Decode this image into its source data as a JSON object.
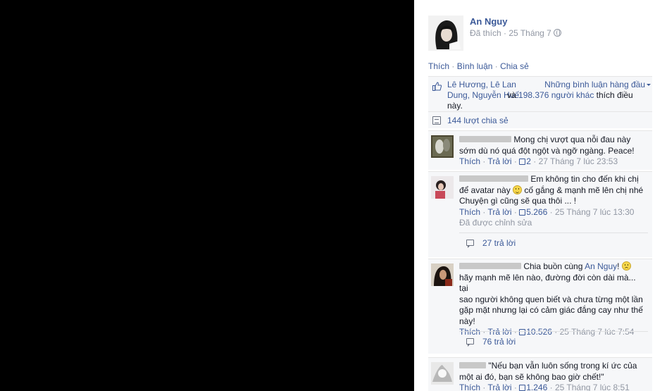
{
  "post": {
    "author": "An Nguy",
    "meta": "Đã thích · 25 Tháng 7",
    "actions": {
      "like": "Thích",
      "comment": "Bình luận",
      "share": "Chia sẻ"
    }
  },
  "likes": {
    "text_line1": "Lê Hương, Lê Lan",
    "text_line2": "Dung, Nguyễn Huế",
    "and": " và ",
    "others": "198.376 người khác",
    "tail": "thích điều",
    "tail2": "này.",
    "top_comments": "Những bình luận hàng đầu"
  },
  "shares": "144 lượt chia sẻ",
  "comments": [
    {
      "line1": "Mong chị vượt qua nỗi đau này",
      "line2": "sớm dù nó quá đột ngột và ngỡ ngàng. Peace!",
      "like": "Thích",
      "reply": "Trả lời",
      "likes": "2",
      "time": "27 Tháng 7 lúc 23:53"
    },
    {
      "line1": "Em không tin cho đến khi chị",
      "line2a": "để avatar này",
      "line2b": "cố gắng & mạnh mẽ lên chị nhé",
      "line3": "Chuyện gì cũng sẽ qua thôi ... !",
      "like": "Thích",
      "reply": "Trả lời",
      "likes": "5.266",
      "time": "25 Tháng 7 lúc 13:30",
      "edited": "Đã được chỉnh sửa",
      "replies": "27 trả lời"
    },
    {
      "line1a": "Chia buồn cùng",
      "mention": "An Nguy",
      "line1b": "!",
      "line2": "hãy mạnh mẽ lên nào, đường đời còn dài mà... tại",
      "line3": "sao người không quen biết và chưa từng một lần",
      "line4": "gặp mặt nhưng lại có cảm giác đắng cay như thế",
      "line5": "này!",
      "like": "Thích",
      "reply": "Trả lời",
      "likes": "10.526",
      "time": "25 Tháng 7 lúc 7:54",
      "replies": "76 trả lời"
    },
    {
      "line1": "\"Nếu bạn vẫn luôn sống trong kí ức của",
      "line2": "một ai đó, bạn sẽ không bao giờ chết!\"",
      "like": "Thích",
      "reply": "Trả lời",
      "likes": "1.246",
      "time": "25 Tháng 7 lúc 8:51"
    }
  ],
  "colors": {
    "link": "#3b5998",
    "muted": "#9197a3",
    "bg": "#f6f7f9",
    "photo": "#000000"
  }
}
